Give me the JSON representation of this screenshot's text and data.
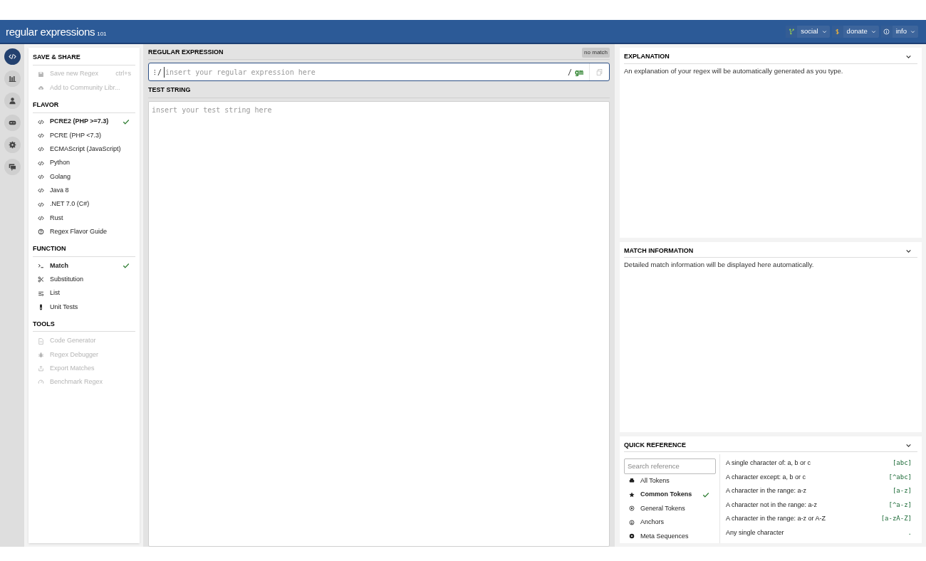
{
  "header": {
    "logo": "regular expressions",
    "logo_sub": "101",
    "menus": [
      {
        "label": "social"
      },
      {
        "label": "donate"
      },
      {
        "label": "info"
      }
    ]
  },
  "rail": [
    {
      "selected": true
    },
    {
      "selected": false
    },
    {
      "selected": false
    },
    {
      "selected": false
    },
    {
      "selected": false
    },
    {
      "selected": false
    }
  ],
  "sidebar": {
    "sections": [
      {
        "title": "SAVE & SHARE",
        "items": [
          {
            "label": "Save new Regex",
            "shortcut": "ctrl+s",
            "disabled": true,
            "selected": false
          },
          {
            "label": "Add to Community Libr...",
            "disabled": true,
            "selected": false
          }
        ]
      },
      {
        "title": "FLAVOR",
        "items": [
          {
            "label": "PCRE2 (PHP >=7.3)",
            "disabled": false,
            "selected": true
          },
          {
            "label": "PCRE (PHP <7.3)",
            "disabled": false,
            "selected": false
          },
          {
            "label": "ECMAScript (JavaScript)",
            "disabled": false,
            "selected": false
          },
          {
            "label": "Python",
            "disabled": false,
            "selected": false
          },
          {
            "label": "Golang",
            "disabled": false,
            "selected": false
          },
          {
            "label": "Java 8",
            "disabled": false,
            "selected": false
          },
          {
            "label": ".NET 7.0 (C#)",
            "disabled": false,
            "selected": false
          },
          {
            "label": "Rust",
            "disabled": false,
            "selected": false
          },
          {
            "label": "Regex Flavor Guide",
            "disabled": false,
            "selected": false
          }
        ]
      },
      {
        "title": "FUNCTION",
        "items": [
          {
            "label": "Match",
            "disabled": false,
            "selected": true
          },
          {
            "label": "Substitution",
            "disabled": false,
            "selected": false
          },
          {
            "label": "List",
            "disabled": false,
            "selected": false
          },
          {
            "label": "Unit Tests",
            "disabled": false,
            "selected": false
          }
        ]
      },
      {
        "title": "TOOLS",
        "items": [
          {
            "label": "Code Generator",
            "disabled": true,
            "selected": false
          },
          {
            "label": "Regex Debugger",
            "disabled": true,
            "selected": false
          },
          {
            "label": "Export Matches",
            "disabled": true,
            "selected": false
          },
          {
            "label": "Benchmark Regex",
            "disabled": true,
            "selected": false
          }
        ]
      }
    ]
  },
  "editor": {
    "regex_title": "REGULAR EXPRESSION",
    "status_badge": "no match",
    "handle": "⁝",
    "open_delimiter": "/",
    "regex_placeholder": "insert your regular expression here",
    "close_delimiter": "/",
    "flags": "gm",
    "test_title": "TEST STRING",
    "test_placeholder": "insert your test string here"
  },
  "explanation": {
    "title": "EXPLANATION",
    "text": "An explanation of your regex will be automatically generated as you type."
  },
  "match_information": {
    "title": "MATCH INFORMATION",
    "text": "Detailed match information will be displayed here automatically."
  },
  "quick_reference": {
    "title": "QUICK REFERENCE",
    "search_placeholder": "Search reference",
    "categories": [
      {
        "label": "All Tokens",
        "selected": false
      },
      {
        "label": "Common Tokens",
        "selected": true
      },
      {
        "label": "General Tokens",
        "selected": false
      },
      {
        "label": "Anchors",
        "selected": false
      },
      {
        "label": "Meta Sequences",
        "selected": false
      }
    ],
    "tokens": [
      {
        "description": "A single character of: a, b or c",
        "token": "[abc]"
      },
      {
        "description": "A character except: a, b or c",
        "token": "[^abc]"
      },
      {
        "description": "A character in the range: a-z",
        "token": "[a-z]"
      },
      {
        "description": "A character not in the range: a-z",
        "token": "[^a-z]"
      },
      {
        "description": "A character in the range: a-z or A-Z",
        "token": "[a-zA-Z]"
      },
      {
        "description": "Any single character",
        "token": "."
      }
    ]
  }
}
